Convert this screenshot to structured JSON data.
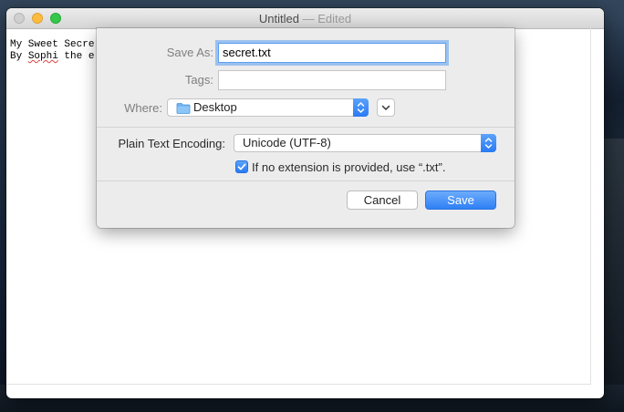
{
  "window": {
    "title": "Untitled",
    "title_suffix": " — Edited",
    "document_lines": [
      "My Sweet Secre",
      "By Sophi the e"
    ],
    "misspelled_word": "Sophi"
  },
  "save_dialog": {
    "save_as_label": "Save As:",
    "save_as_value": "secret.txt",
    "tags_label": "Tags:",
    "tags_value": "",
    "where_label": "Where:",
    "where_value": "Desktop",
    "encoding_label": "Plain Text Encoding:",
    "encoding_value": "Unicode (UTF-8)",
    "extension_checkbox_label": "If no extension is provided, use “.txt”.",
    "extension_checkbox_checked": true,
    "cancel_label": "Cancel",
    "save_label": "Save"
  },
  "icons": {
    "where_folder": "folder-icon",
    "expand": "chevron-down-icon",
    "popup_arrows": "updown-chevron-icon",
    "checkmark": "checkmark-icon"
  },
  "colors": {
    "accent": "#2f80f6",
    "close": "#d0d0d0",
    "minimize": "#fdbc40",
    "maximize": "#34c84a"
  }
}
